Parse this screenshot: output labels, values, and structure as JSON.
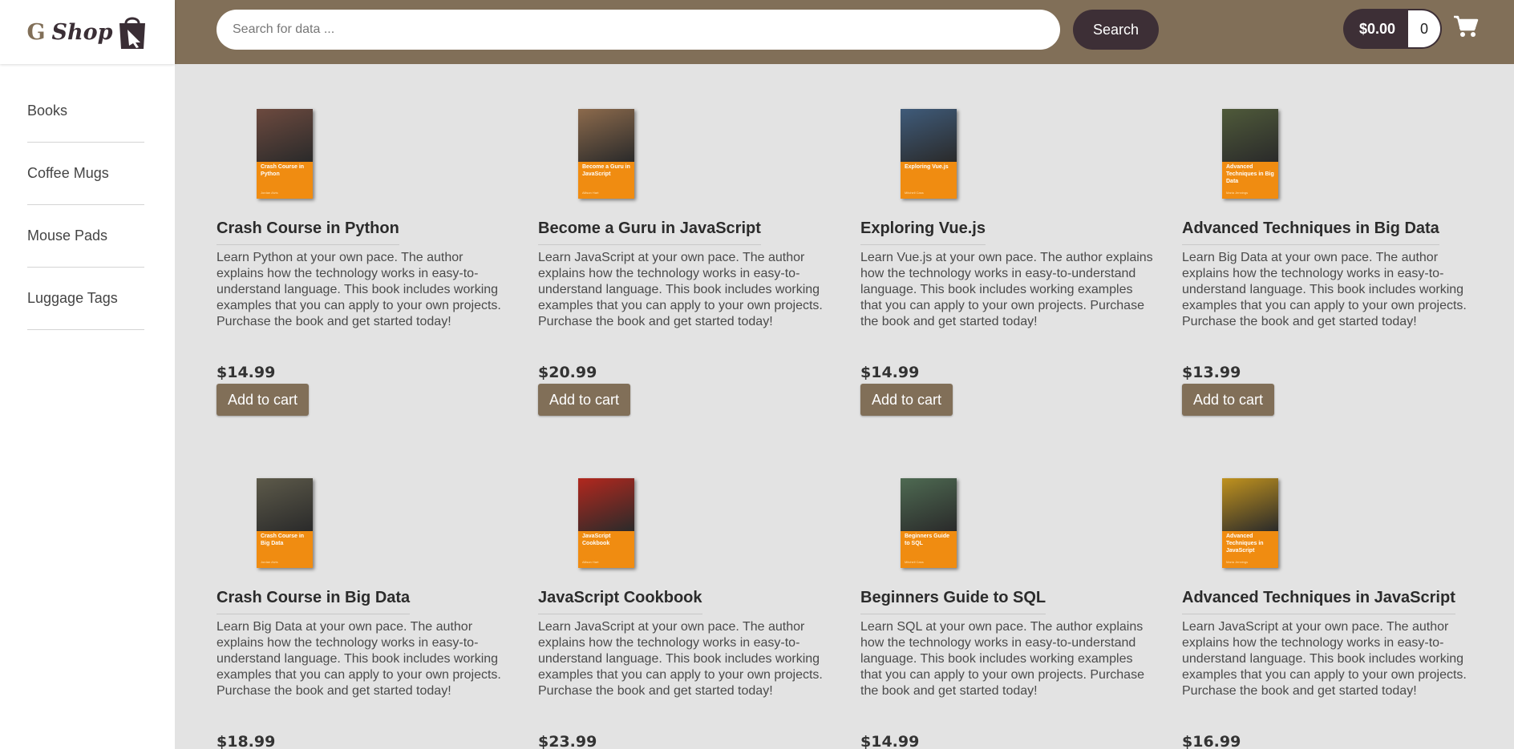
{
  "brand": {
    "letter": "G",
    "name": "Shop"
  },
  "search": {
    "placeholder": "Search for data ...",
    "button_label": "Search"
  },
  "cart": {
    "total": "$0.00",
    "count": "0"
  },
  "sidebar": {
    "items": [
      {
        "label": "Books"
      },
      {
        "label": "Coffee Mugs"
      },
      {
        "label": "Mouse Pads"
      },
      {
        "label": "Luggage Tags"
      }
    ]
  },
  "products": [
    {
      "title": "Crash Course in Python",
      "cover_title": "Crash Course in Python",
      "cover_author": "Jordan Alvis",
      "description": "Learn Python at your own pace. The author explains how the technology works in easy-to-understand language. This book includes working examples that you can apply to your own projects. Purchase the book and get started today!",
      "price": "$14.99",
      "button": "Add to cart",
      "photo_color": "#6d4a3f"
    },
    {
      "title": "Become a Guru in JavaScript",
      "cover_title": "Become a Guru in JavaScript",
      "cover_author": "Allison Hart",
      "description": "Learn JavaScript at your own pace. The author explains how the technology works in easy-to-understand language. This book includes working examples that you can apply to your own projects. Purchase the book and get started today!",
      "price": "$20.99",
      "button": "Add to cart",
      "photo_color": "#8c6a4c"
    },
    {
      "title": "Exploring Vue.js",
      "cover_title": "Exploring Vue.js",
      "cover_author": "Mitchell Cass",
      "description": "Learn Vue.js at your own pace. The author explains how the technology works in easy-to-understand language. This book includes working examples that you can apply to your own projects. Purchase the book and get started today!",
      "price": "$14.99",
      "button": "Add to cart",
      "photo_color": "#3f5b7a"
    },
    {
      "title": "Advanced Techniques in Big Data",
      "cover_title": "Advanced Techniques in Big Data",
      "cover_author": "Maria Jennings",
      "description": "Learn Big Data at your own pace. The author explains how the technology works in easy-to-understand language. This book includes working examples that you can apply to your own projects. Purchase the book and get started today!",
      "price": "$13.99",
      "button": "Add to cart",
      "photo_color": "#4f5a3a"
    },
    {
      "title": "Crash Course in Big Data",
      "cover_title": "Crash Course in Big Data",
      "cover_author": "Jordan Alvis",
      "description": "Learn Big Data at your own pace. The author explains how the technology works in easy-to-understand language. This book includes working examples that you can apply to your own projects. Purchase the book and get started today!",
      "price": "$18.99",
      "button": "Add to cart",
      "photo_color": "#5d5a4a"
    },
    {
      "title": "JavaScript Cookbook",
      "cover_title": "JavaScript Cookbook",
      "cover_author": "Allison Hart",
      "description": "Learn JavaScript at your own pace. The author explains how the technology works in easy-to-understand language. This book includes working examples that you can apply to your own projects. Purchase the book and get started today!",
      "price": "$23.99",
      "button": "Add to cart",
      "photo_color": "#b2281e"
    },
    {
      "title": "Beginners Guide to SQL",
      "cover_title": "Beginners Guide to SQL",
      "cover_author": "Mitchell Cass",
      "description": "Learn SQL at your own pace. The author explains how the technology works in easy-to-understand language. This book includes working examples that you can apply to your own projects. Purchase the book and get started today!",
      "price": "$14.99",
      "button": "Add to cart",
      "photo_color": "#4e6a52"
    },
    {
      "title": "Advanced Techniques in JavaScript",
      "cover_title": "Advanced Techniques in JavaScript",
      "cover_author": "Maria Jennings",
      "description": "Learn JavaScript at your own pace. The author explains how the technology works in easy-to-understand language. This book includes working examples that you can apply to your own projects. Purchase the book and get started today!",
      "price": "$16.99",
      "button": "Add to cart",
      "photo_color": "#c0921e"
    }
  ],
  "colors": {
    "header": "#816f58",
    "dark": "#3d2f36",
    "cover_band": "#f08c11",
    "background": "#e3e3e3"
  }
}
